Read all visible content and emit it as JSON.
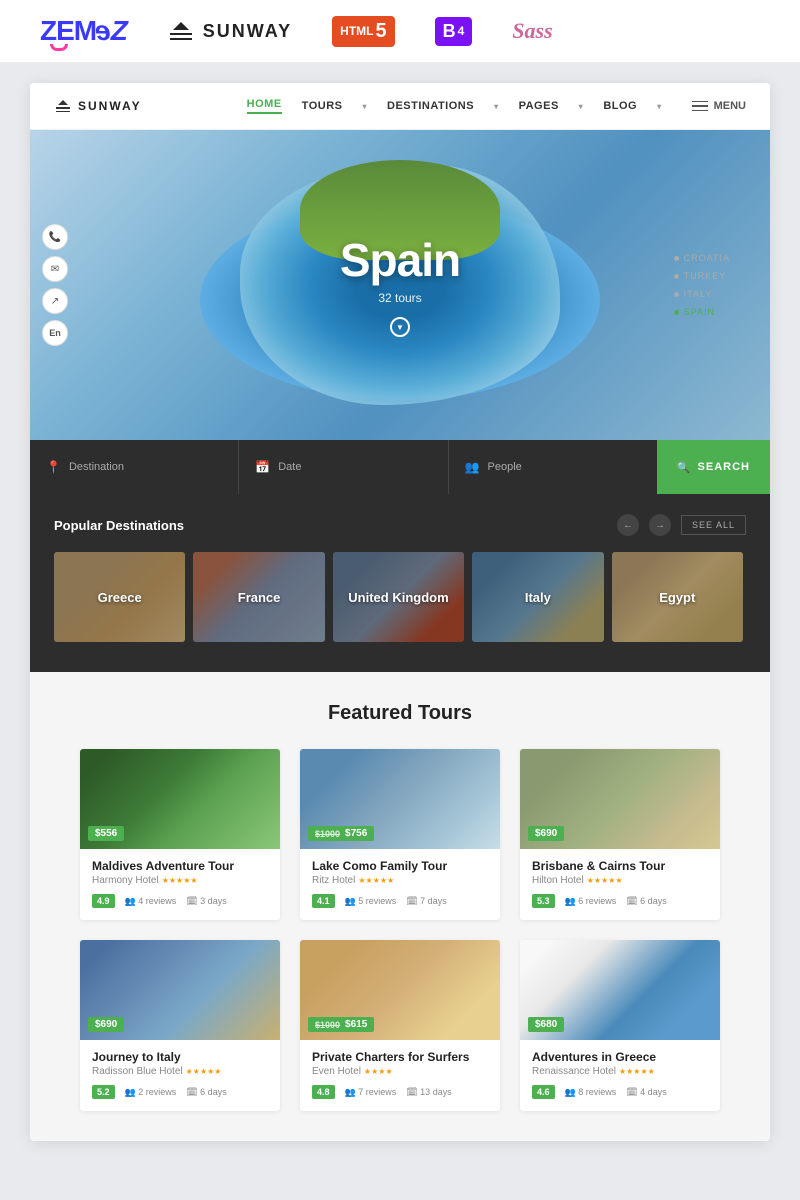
{
  "topBar": {
    "zemes": "ZEMeZ",
    "sunway": "SUNWAY",
    "html5": "HTML",
    "html5num": "5",
    "bootstrap": "B",
    "bootstrap_num": "4",
    "sass": "Sass"
  },
  "nav": {
    "logo": "SUNWAY",
    "home": "HOME",
    "tours": "TOURS",
    "destinations": "DESTINATIONS",
    "pages": "PAGES",
    "blog": "BLOG",
    "menu": "MENU"
  },
  "hero": {
    "title": "Spain",
    "subtitle": "32 tours",
    "breadcrumbs": [
      {
        "label": "CROATIA",
        "active": false
      },
      {
        "label": "TURKEY",
        "active": false
      },
      {
        "label": "ITALY",
        "active": false
      },
      {
        "label": "SPAIN",
        "active": true
      }
    ]
  },
  "searchBar": {
    "destination_placeholder": "Destination",
    "date_placeholder": "Date",
    "people_placeholder": "People",
    "search_btn": "SEARCH"
  },
  "destinations": {
    "title": "Popular Destinations",
    "see_all": "SEE ALL",
    "cards": [
      {
        "label": "Greece",
        "class": "greece"
      },
      {
        "label": "France",
        "class": "france"
      },
      {
        "label": "United Kingdom",
        "class": "uk"
      },
      {
        "label": "Italy",
        "class": "italy"
      },
      {
        "label": "Egypt",
        "class": "egypt"
      }
    ]
  },
  "featured": {
    "title": "Featured Tours",
    "tours": [
      {
        "name": "Maldives Adventure Tour",
        "hotel": "Harmony Hotel 5*",
        "price": "$556",
        "old_price": null,
        "rating": "4.9",
        "reviews": "4 reviews",
        "days": "3 days",
        "img_class": "maldives",
        "rating_class": "green"
      },
      {
        "name": "Lake Como Family Tour",
        "hotel": "Ritz Hotel 5*",
        "price": "$756",
        "old_price": "$1000",
        "rating": "4.1",
        "reviews": "5 reviews",
        "days": "7 days",
        "img_class": "lake",
        "rating_class": "green"
      },
      {
        "name": "Brisbane & Cairns Tour",
        "hotel": "Hilton Hotel 5*",
        "price": "$690",
        "old_price": null,
        "rating": "5.3",
        "reviews": "6 reviews",
        "days": "6 days",
        "img_class": "brisbane",
        "rating_class": "green"
      },
      {
        "name": "Journey to Italy",
        "hotel": "Radisson Blue Hotel 5*",
        "price": "$690",
        "old_price": null,
        "rating": "5.2",
        "reviews": "2 reviews",
        "days": "6 days",
        "img_class": "italy2",
        "rating_class": "green"
      },
      {
        "name": "Private Charters for Surfers",
        "hotel": "Even Hotel 4*",
        "price": "$615",
        "old_price": "$1000",
        "rating": "4.8",
        "reviews": "7 reviews",
        "days": "13 days",
        "img_class": "surfers",
        "rating_class": "green"
      },
      {
        "name": "Adventures in Greece",
        "hotel": "Renaissance Hotel 5*",
        "price": "$680",
        "old_price": null,
        "rating": "4.6",
        "reviews": "8 reviews",
        "days": "4 days",
        "img_class": "greece2",
        "rating_class": "green"
      }
    ]
  }
}
